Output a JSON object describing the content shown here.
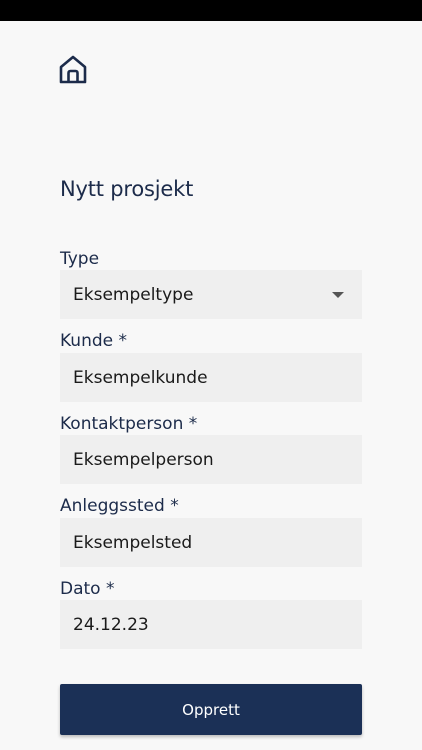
{
  "colors": {
    "primary": "#1b3056",
    "text": "#1c2b4a",
    "field_bg": "#efefef",
    "page_bg": "#f8f8f8"
  },
  "header": {
    "home_icon": "home-icon"
  },
  "form": {
    "title": "Nytt prosjekt",
    "type": {
      "label": "Type",
      "value": "Eksempeltype",
      "icon": "chevron-down-icon"
    },
    "kunde": {
      "label": "Kunde *",
      "value": "Eksempelkunde"
    },
    "kontaktperson": {
      "label": "Kontaktperson *",
      "value": "Eksempelperson"
    },
    "anleggssted": {
      "label": "Anleggssted *",
      "value": "Eksempelsted"
    },
    "dato": {
      "label": "Dato *",
      "value": "24.12.23"
    },
    "submit_label": "Opprett"
  }
}
